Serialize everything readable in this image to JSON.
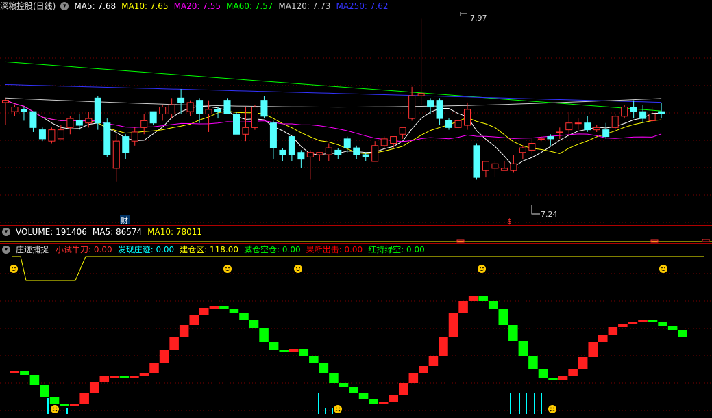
{
  "price_panel": {
    "title": "深粮控股(日线)",
    "ma_labels": [
      {
        "text": "MA5: 7.68",
        "color": "#ffffff"
      },
      {
        "text": "MA10: 7.65",
        "color": "#ffff00"
      },
      {
        "text": "MA20: 7.55",
        "color": "#ff00ff"
      },
      {
        "text": "MA60: 7.57",
        "color": "#00ff00"
      },
      {
        "text": "MA120: 7.73",
        "color": "#cccccc"
      },
      {
        "text": "MA250: 7.62",
        "color": "#3333ff"
      }
    ],
    "high_label": "7.97",
    "low_label": "7.24",
    "marker_cai": "财",
    "marker_dollar": "$"
  },
  "volume_panel": {
    "labels": [
      {
        "text": "VOLUME: 191406",
        "color": "#ffffff"
      },
      {
        "text": "MA5: 86574",
        "color": "#ffffff"
      },
      {
        "text": "MA10: 78011",
        "color": "#ffff00"
      }
    ]
  },
  "indicator_panel": {
    "title": "庄迹捕捉",
    "labels": [
      {
        "text": "小试牛刀: 0.00",
        "color": "#ff3030"
      },
      {
        "text": "发现庄迹: 0.00",
        "color": "#00ffff"
      },
      {
        "text": "建仓区: 118.00",
        "color": "#ffff00"
      },
      {
        "text": "减仓空仓: 0.00",
        "color": "#00ff00"
      },
      {
        "text": "果断出击: 0.00",
        "color": "#ff0000"
      },
      {
        "text": "红持绿空: 0.00",
        "color": "#00ff00"
      }
    ],
    "smile_icon": "smiley-icon",
    "sad_icon": "frown-icon"
  },
  "colors": {
    "up": "#ff3232",
    "down": "#54ffff",
    "grid": "#7a0000"
  },
  "chart_data": {
    "type": "candlestick",
    "y_range_visible": [
      7.24,
      7.97
    ],
    "candles": [
      [
        7.6,
        7.61,
        7.5,
        7.62
      ],
      [
        7.56,
        7.58,
        7.54,
        7.59
      ],
      [
        7.57,
        7.56,
        7.52,
        7.58
      ],
      [
        7.56,
        7.49,
        7.47,
        7.56
      ],
      [
        7.48,
        7.44,
        7.43,
        7.49
      ],
      [
        7.43,
        7.48,
        7.42,
        7.49
      ],
      [
        7.44,
        7.48,
        7.44,
        7.5
      ],
      [
        7.49,
        7.53,
        7.46,
        7.54
      ],
      [
        7.52,
        7.5,
        7.48,
        7.55
      ],
      [
        7.51,
        7.53,
        7.49,
        7.56
      ],
      [
        7.62,
        7.51,
        7.48,
        7.63
      ],
      [
        7.51,
        7.37,
        7.36,
        7.53
      ],
      [
        7.31,
        7.43,
        7.25,
        7.46
      ],
      [
        7.45,
        7.38,
        7.35,
        7.46
      ],
      [
        7.43,
        7.47,
        7.41,
        7.49
      ],
      [
        7.49,
        7.52,
        7.46,
        7.55
      ],
      [
        7.56,
        7.51,
        7.5,
        7.56
      ],
      [
        7.55,
        7.58,
        7.52,
        7.59
      ],
      [
        7.55,
        7.59,
        7.53,
        7.62
      ],
      [
        7.62,
        7.6,
        7.55,
        7.66
      ],
      [
        7.56,
        7.6,
        7.54,
        7.61
      ],
      [
        7.61,
        7.55,
        7.51,
        7.62
      ],
      [
        7.55,
        7.57,
        7.47,
        7.61
      ],
      [
        7.57,
        7.56,
        7.53,
        7.58
      ],
      [
        7.61,
        7.55,
        7.55,
        7.62
      ],
      [
        7.55,
        7.46,
        7.46,
        7.56
      ],
      [
        7.46,
        7.49,
        7.43,
        7.58
      ],
      [
        7.49,
        7.58,
        7.48,
        7.59
      ],
      [
        7.61,
        7.54,
        7.53,
        7.63
      ],
      [
        7.51,
        7.4,
        7.35,
        7.52
      ],
      [
        7.39,
        7.37,
        7.34,
        7.4
      ],
      [
        7.45,
        7.37,
        7.34,
        7.45
      ],
      [
        7.38,
        7.35,
        7.31,
        7.39
      ],
      [
        7.36,
        7.38,
        7.26,
        7.39
      ],
      [
        7.37,
        7.38,
        7.34,
        7.38
      ],
      [
        7.37,
        7.4,
        7.34,
        7.42
      ],
      [
        7.39,
        7.37,
        7.35,
        7.4
      ],
      [
        7.44,
        7.4,
        7.38,
        7.45
      ],
      [
        7.4,
        7.37,
        7.35,
        7.41
      ],
      [
        7.37,
        7.36,
        7.34,
        7.38
      ],
      [
        7.34,
        7.41,
        7.34,
        7.43
      ],
      [
        7.41,
        7.44,
        7.39,
        7.45
      ],
      [
        7.42,
        7.45,
        7.4,
        7.45
      ],
      [
        7.46,
        7.49,
        7.44,
        7.49
      ],
      [
        7.53,
        7.63,
        7.52,
        7.67
      ],
      [
        7.63,
        7.64,
        7.59,
        7.97
      ],
      [
        7.61,
        7.58,
        7.55,
        7.62
      ],
      [
        7.61,
        7.53,
        7.5,
        7.62
      ],
      [
        7.52,
        7.49,
        7.48,
        7.53
      ],
      [
        7.49,
        7.52,
        7.48,
        7.54
      ],
      [
        7.5,
        7.57,
        7.48,
        7.6
      ],
      [
        7.41,
        7.27,
        7.26,
        7.42
      ],
      [
        7.3,
        7.34,
        7.27,
        7.34
      ],
      [
        7.31,
        7.33,
        7.27,
        7.34
      ],
      [
        7.3,
        7.31,
        7.3,
        7.34
      ],
      [
        7.3,
        7.33,
        7.29,
        7.37
      ],
      [
        7.38,
        7.4,
        7.35,
        7.41
      ],
      [
        7.39,
        7.42,
        7.37,
        7.44
      ],
      [
        7.44,
        7.44,
        7.43,
        7.45
      ],
      [
        7.45,
        7.44,
        7.41,
        7.46
      ],
      [
        7.47,
        7.47,
        7.44,
        7.49
      ],
      [
        7.48,
        7.51,
        7.45,
        7.56
      ],
      [
        7.51,
        7.51,
        7.48,
        7.53
      ],
      [
        7.51,
        7.48,
        7.47,
        7.54
      ],
      [
        7.48,
        7.49,
        7.47,
        7.5
      ],
      [
        7.48,
        7.45,
        7.44,
        7.51
      ],
      [
        7.49,
        7.54,
        7.48,
        7.55
      ],
      [
        7.54,
        7.58,
        7.53,
        7.59
      ],
      [
        7.58,
        7.56,
        7.53,
        7.61
      ],
      [
        7.56,
        7.53,
        7.51,
        7.59
      ],
      [
        7.52,
        7.55,
        7.51,
        7.58
      ],
      [
        7.56,
        7.55,
        7.53,
        7.6
      ]
    ]
  }
}
